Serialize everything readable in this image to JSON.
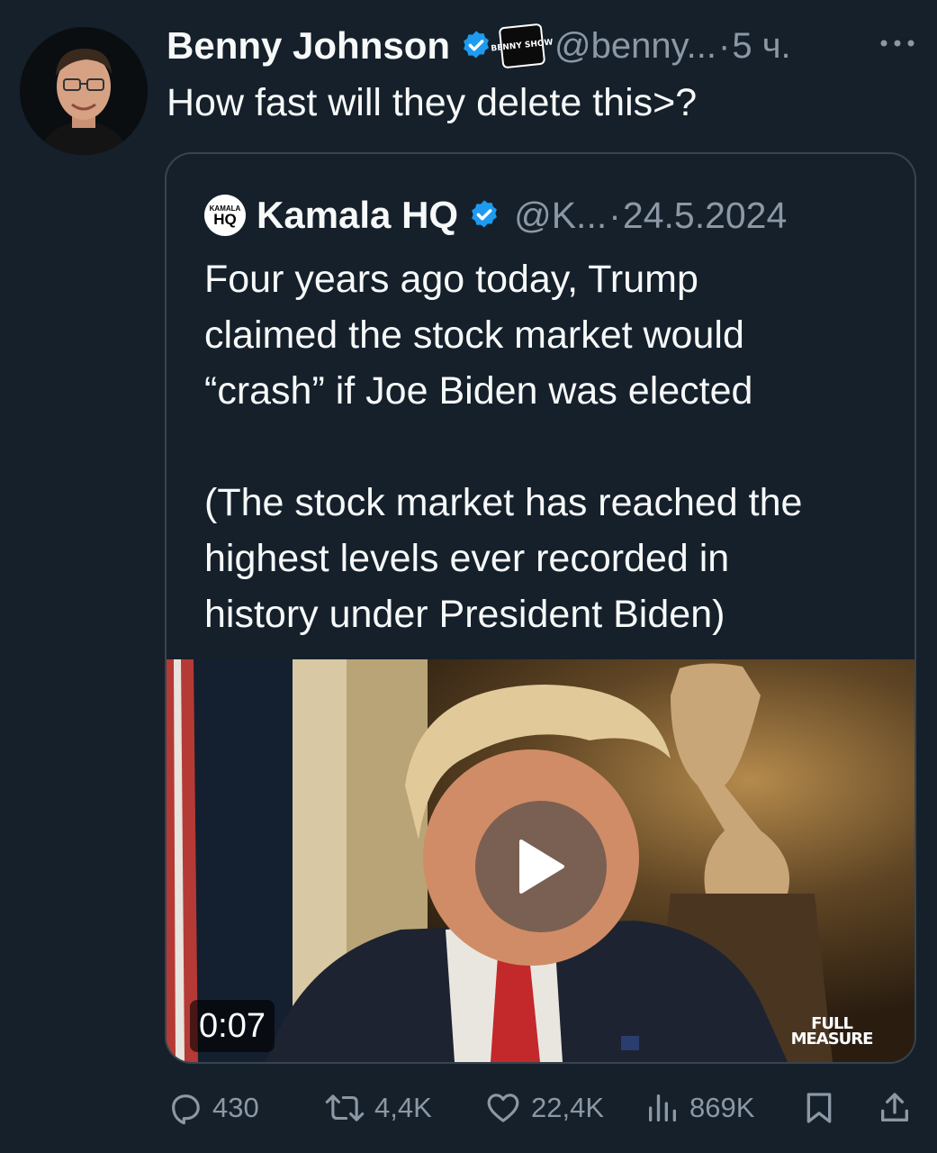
{
  "tweet": {
    "author_name": "Benny Johnson",
    "affiliate_badge_text": "BENNY SHOW",
    "handle": "@benny...",
    "separator": "·",
    "time_ago": "5 ч.",
    "more_icon": "more-icon",
    "text": "How fast will they delete this>?"
  },
  "quoted": {
    "avatar_text_small": "KAMALA",
    "avatar_text_big": "HQ",
    "author_name": "Kamala HQ",
    "handle": "@K...",
    "separator": "·",
    "date": "24.5.2024",
    "text_line_1": "Four years ago today, Trump",
    "text_line_2": "claimed the stock market would",
    "text_line_3": "“crash” if Joe Biden was elected",
    "text_line_5": "(The stock market has reached the",
    "text_line_6": "highest levels ever recorded in",
    "text_line_7": "history under President Biden)",
    "video": {
      "duration": "0:07",
      "watermark_line_1": "FULL",
      "watermark_line_2": "MEASURE"
    }
  },
  "actions": {
    "replies": "430",
    "reposts": "4,4K",
    "likes": "22,4K",
    "views": "869K"
  },
  "colors": {
    "background": "#15202b",
    "text": "#f7f9f9",
    "secondary": "#8b98a5",
    "verified": "#1d9bf0",
    "border": "#38444d"
  }
}
